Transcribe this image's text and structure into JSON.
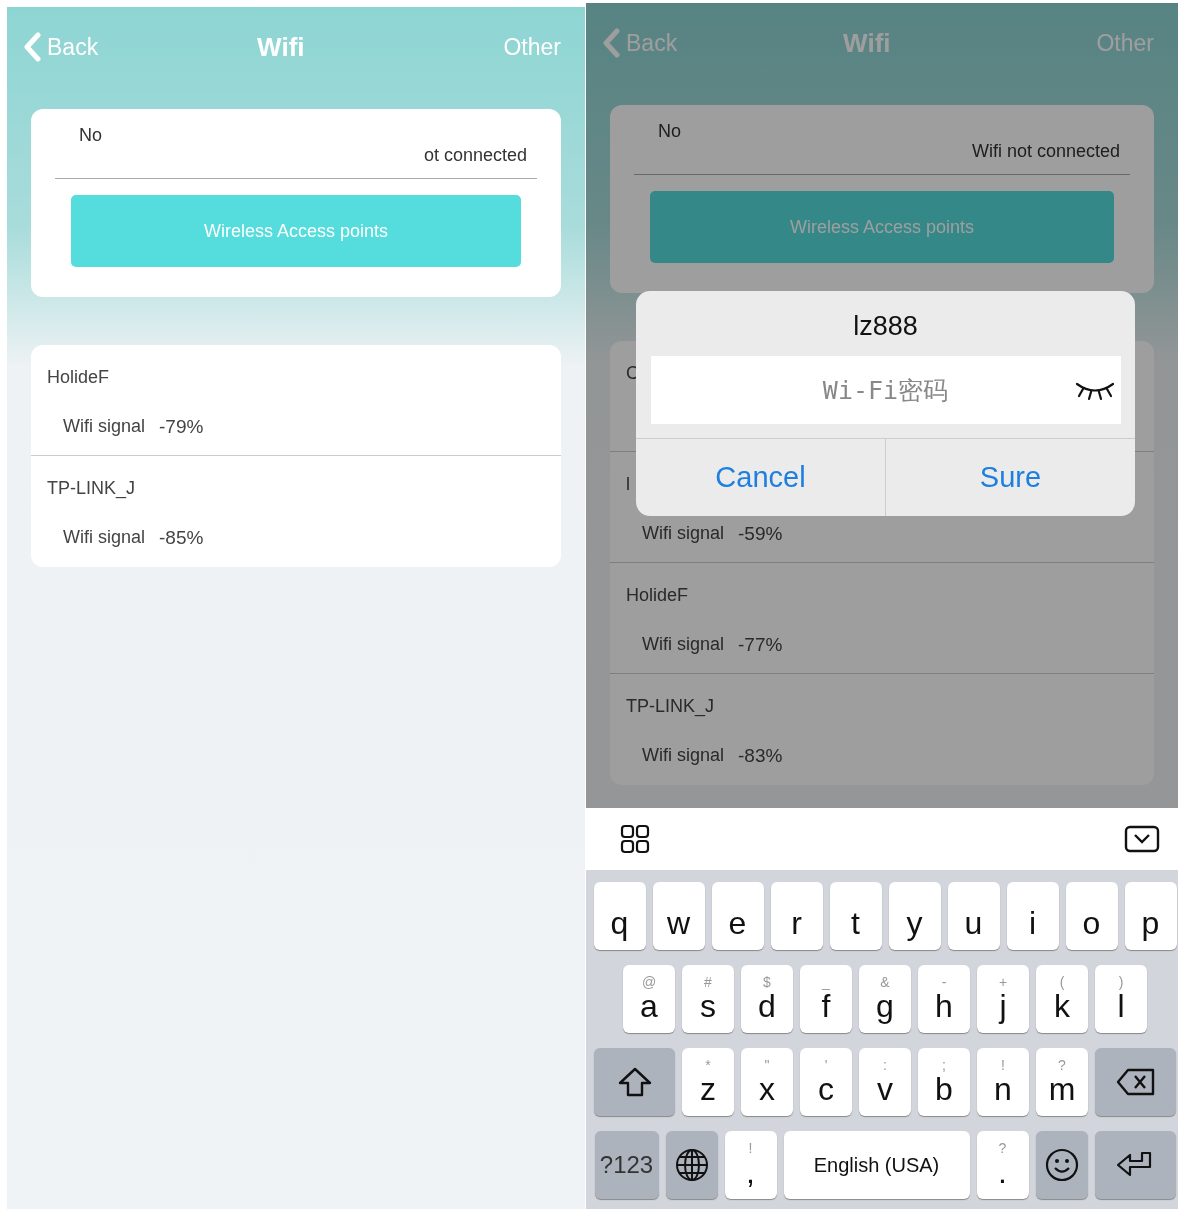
{
  "screens": [
    {
      "dimmed": false,
      "header": {
        "back": "Back",
        "title": "Wifi",
        "action": "Other"
      },
      "status": {
        "label": "No",
        "value": "ot connected"
      },
      "button": "Wireless Access points",
      "networks": [
        {
          "name": "HolideF",
          "signal_label": "Wifi signal",
          "signal": "-79%"
        },
        {
          "name": "TP-LINK_J",
          "signal_label": "Wifi signal",
          "signal": "-85%"
        }
      ]
    },
    {
      "dimmed": true,
      "header": {
        "back": "Back",
        "title": "Wifi",
        "action": "Other"
      },
      "status": {
        "label": "No",
        "value": "Wifi not connected"
      },
      "button": "Wireless Access points",
      "networks": [
        {
          "name": "C"
        },
        {
          "name": "l",
          "signal_label": "Wifi signal",
          "signal": "-59%"
        },
        {
          "name": "HolideF",
          "signal_label": "Wifi signal",
          "signal": "-77%"
        },
        {
          "name": "TP-LINK_J",
          "signal_label": "Wifi signal",
          "signal": "-83%"
        }
      ],
      "dialog": {
        "title": "lz888",
        "placeholder": "Wi-Fi密码",
        "buttons": [
          "Cancel",
          "Sure"
        ]
      },
      "keyboard": {
        "rows": [
          {
            "keys": [
              {
                "label": "q"
              },
              {
                "label": "w"
              },
              {
                "label": "e"
              },
              {
                "label": "r"
              },
              {
                "label": "t"
              },
              {
                "label": "y"
              },
              {
                "label": "u"
              },
              {
                "label": "i"
              },
              {
                "label": "o"
              },
              {
                "label": "p"
              }
            ]
          },
          {
            "keys": [
              {
                "label": "a",
                "hint": "@"
              },
              {
                "label": "s",
                "hint": "#"
              },
              {
                "label": "d",
                "hint": "$"
              },
              {
                "label": "f",
                "hint": "_"
              },
              {
                "label": "g",
                "hint": "&"
              },
              {
                "label": "h",
                "hint": "-"
              },
              {
                "label": "j",
                "hint": "+"
              },
              {
                "label": "k",
                "hint": "("
              },
              {
                "label": "l",
                "hint": ")"
              }
            ]
          },
          {
            "keys": [
              {
                "kind": "shift"
              },
              {
                "label": "z",
                "hint": "*"
              },
              {
                "label": "x",
                "hint": "\""
              },
              {
                "label": "c",
                "hint": "'"
              },
              {
                "label": "v",
                "hint": ":"
              },
              {
                "label": "b",
                "hint": ";"
              },
              {
                "label": "n",
                "hint": "!"
              },
              {
                "label": "m",
                "hint": "?"
              },
              {
                "kind": "backspace"
              }
            ]
          },
          {
            "keys": [
              {
                "kind": "symbols",
                "label": "?123"
              },
              {
                "kind": "globe"
              },
              {
                "label": ",",
                "hint": "!"
              },
              {
                "kind": "space",
                "label": "English (USA)"
              },
              {
                "label": ".",
                "hint": "?"
              },
              {
                "kind": "emoji"
              },
              {
                "kind": "return"
              }
            ]
          }
        ]
      }
    }
  ]
}
